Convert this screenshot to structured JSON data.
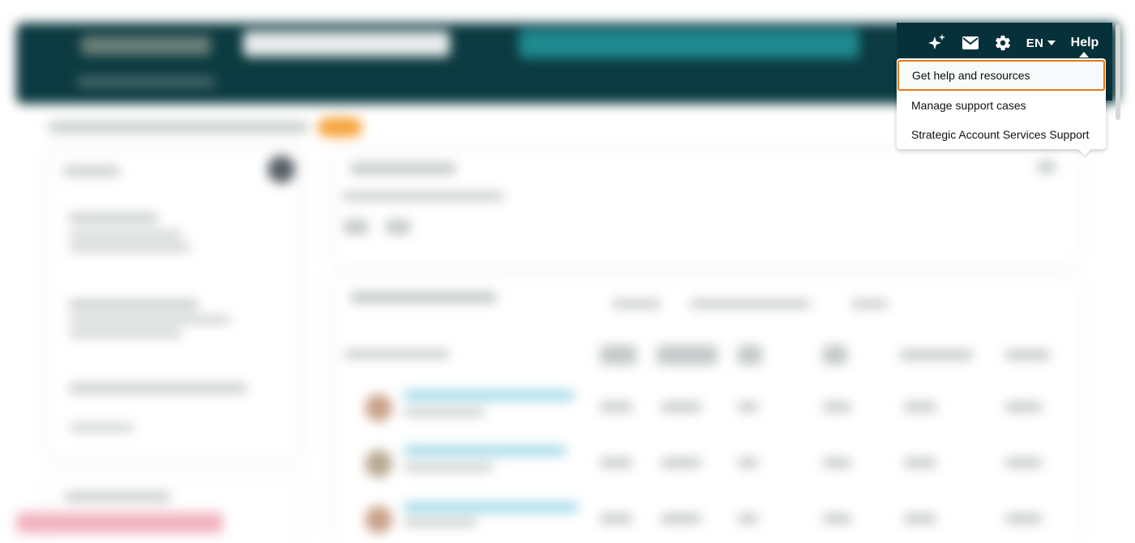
{
  "header": {
    "language_label": "EN",
    "help_label": "Help",
    "icons": {
      "ai": "sparkle-icon",
      "mail": "mail-icon",
      "settings": "gear-icon",
      "language_caret": "caret-down-icon"
    }
  },
  "help_menu": {
    "items": [
      {
        "label": "Get help and resources"
      },
      {
        "label": "Manage support cases"
      },
      {
        "label": "Strategic Account Services Support"
      }
    ]
  },
  "colors": {
    "header_bg": "#06303a",
    "focus_outline": "#e47911",
    "menu_bg": "#ffffff"
  }
}
